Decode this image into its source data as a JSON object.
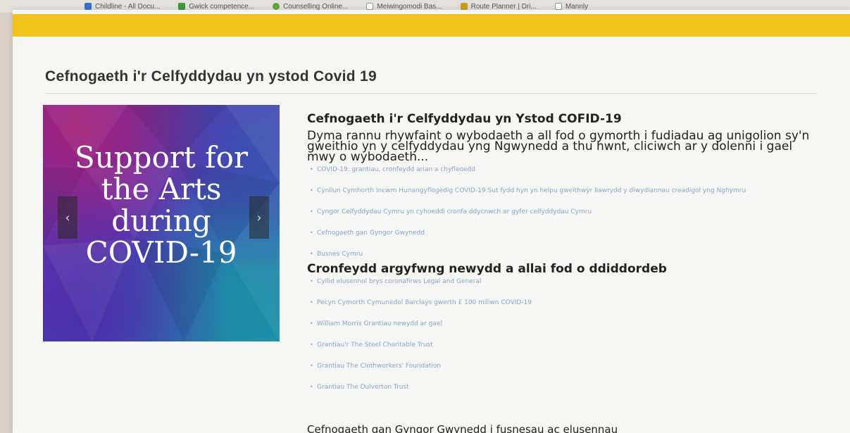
{
  "bookmarks": [
    {
      "label": "Childline - All Docu...",
      "color": "#3b6fd4"
    },
    {
      "label": "Gwick competence...",
      "color": "#3a9b3a"
    },
    {
      "label": "Counselling Online...",
      "color": "#5aa83c"
    },
    {
      "label": "Meiwingomodi Bas...",
      "color": "#aaaaaa"
    },
    {
      "label": "Route Planner | Dri...",
      "color": "#c8a020"
    },
    {
      "label": "Mannly",
      "color": "#aaaaaa"
    }
  ],
  "accent_color": "#f0c31c",
  "page_title": "Cefnogaeth i'r Celfyddydau yn ystod Covid 19",
  "carousel": {
    "slide_lines": [
      "Support for",
      "the Arts",
      "during",
      "COVID-19"
    ],
    "prev_label": "‹",
    "next_label": "›"
  },
  "content": {
    "heading": "Cefnogaeth i'r Celfyddydau yn Ystod COFID-19",
    "intro": "Dyma rannu rhywfaint o wybodaeth a all fod o gymorth i fudiadau ag unigolion sy'n gweithio yn y celfyddydau yng Ngwynedd a thu hwnt, cliciwch ar y dolenni i gael mwy o wybodaeth...",
    "links_1": [
      "COVID-19: grantiau, cronfeydd arian a chyfleoedd",
      "Cynllun Cymhorth Incwm Hunangyflogedig COVID-19:Sut fydd hyn yn helpu gweithwyr llawrydd y diwydiannau creadigol yng Nghymru",
      "Cyngor Celfyddydau Cymru yn cyhoeddi cronfa ddycnwch ar gyfer celfyddydau Cymru",
      "Cefnogaeth gan Gyngor Gwynedd",
      "Busnes Cymru"
    ],
    "subheading": "Cronfeydd argyfwng newydd a allai fod o ddiddordeb",
    "links_2": [
      "Cyllid elusennol brys coronafirws Legal and General",
      "Pecyn Cymorth Cymunedol Barclays gwerth £ 100 miliwn COVID-19",
      "William Morris Grantiau newydd ar gael",
      "Grantiau'r The Steel Charitable Trust",
      "Grantiau The Clothworkers' Foundation",
      "Grantiau The Dulverton Trust"
    ],
    "cutoff_text": "Cefnogaeth gan Gyngor Gwynedd i fusnesau ac elusennau"
  }
}
